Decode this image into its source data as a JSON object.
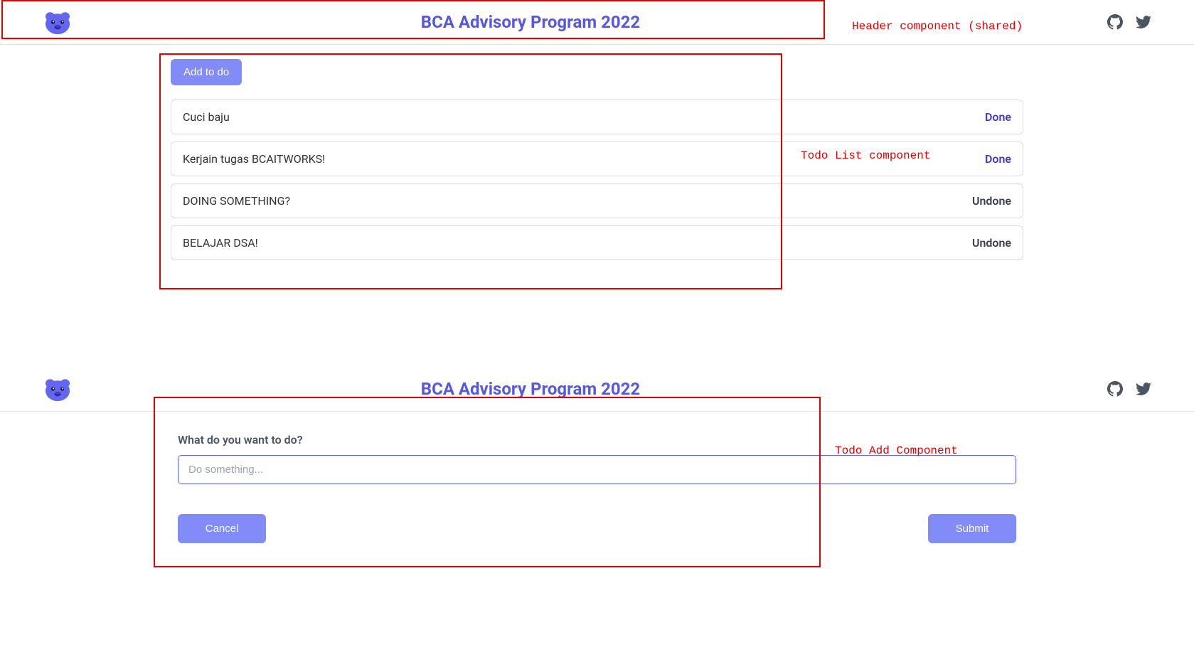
{
  "header": {
    "title": "BCA Advisory Program 2022"
  },
  "annotations": {
    "header_label": "Header component (shared)",
    "list_label": "Todo List component",
    "add_label": "Todo Add Component"
  },
  "list_view": {
    "add_button_label": "Add to do",
    "todos": [
      {
        "text": "Cuci baju",
        "status": "Done",
        "done": true
      },
      {
        "text": "Kerjain tugas BCAITWORKS!",
        "status": "Done",
        "done": true
      },
      {
        "text": "DOING SOMETHING?",
        "status": "Undone",
        "done": false
      },
      {
        "text": "BELAJAR DSA!",
        "status": "Undone",
        "done": false
      }
    ]
  },
  "add_view": {
    "prompt_label": "What do you want to do?",
    "input_placeholder": "Do something...",
    "cancel_label": "Cancel",
    "submit_label": "Submit"
  }
}
